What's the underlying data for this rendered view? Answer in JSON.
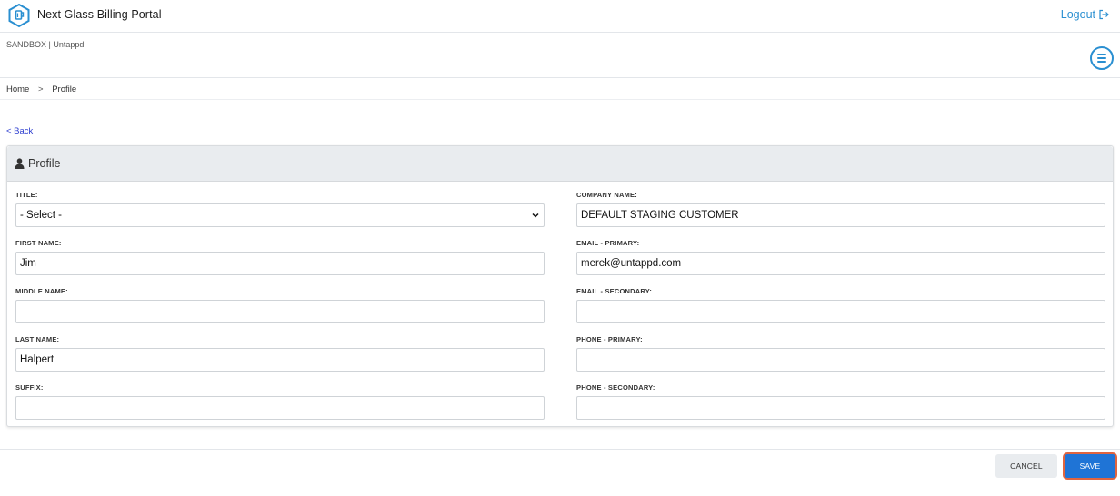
{
  "header": {
    "app_title": "Next Glass Billing Portal",
    "logout_label": "Logout",
    "logo_icon": "next-glass-logo-icon",
    "brand_color": "#2a8fd1"
  },
  "environment": {
    "label": "SANDBOX | Untappd"
  },
  "breadcrumb": {
    "home": "Home",
    "separator": ">",
    "current": "Profile"
  },
  "back_link": "< Back",
  "profile_card": {
    "title": "Profile",
    "title_icon": "user-icon",
    "fields": {
      "title": {
        "label": "TITLE:",
        "value": "- Select -"
      },
      "first_name": {
        "label": "FIRST NAME:",
        "value": "Jim"
      },
      "middle_name": {
        "label": "MIDDLE NAME:",
        "value": ""
      },
      "last_name": {
        "label": "LAST NAME:",
        "value": "Halpert"
      },
      "suffix": {
        "label": "SUFFIX:",
        "value": ""
      },
      "company_name": {
        "label": "COMPANY NAME:",
        "value": "DEFAULT STAGING CUSTOMER"
      },
      "email_primary": {
        "label": "EMAIL - PRIMARY:",
        "value": "merek@untappd.com"
      },
      "email_secondary": {
        "label": "EMAIL - SECONDARY:",
        "value": ""
      },
      "phone_primary": {
        "label": "PHONE - PRIMARY:",
        "value": ""
      },
      "phone_secondary": {
        "label": "PHONE - SECONDARY:",
        "value": ""
      }
    }
  },
  "actions": {
    "cancel_label": "CANCEL",
    "save_label": "SAVE"
  }
}
